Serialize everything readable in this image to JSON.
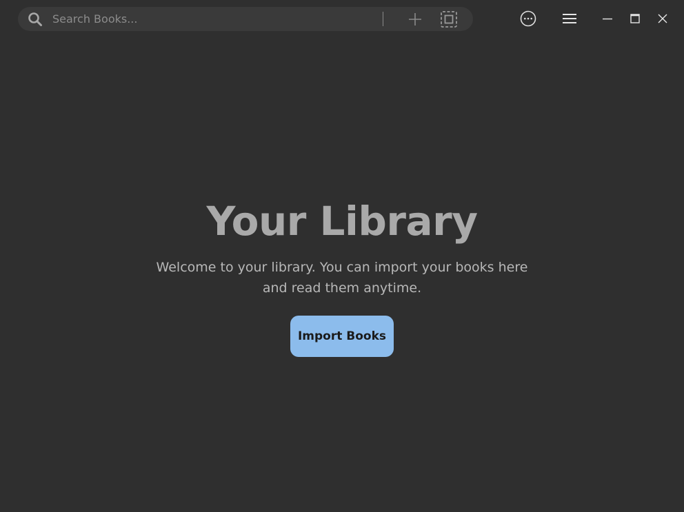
{
  "search": {
    "placeholder": "Search Books...",
    "value": ""
  },
  "icons": {
    "search": "search-icon",
    "add": "plus-icon",
    "select": "dashed-select-icon",
    "more": "more-options-icon",
    "menu": "hamburger-menu-icon",
    "minimize": "window-minimize-icon",
    "maximize": "window-maximize-icon",
    "close": "window-close-icon"
  },
  "main": {
    "title": "Your Library",
    "welcome": "Welcome to your library. You can import your books here and read them anytime.",
    "import_label": "Import Books"
  },
  "colors": {
    "background": "#2f2f2f",
    "search_bg": "#3a3a3a",
    "accent": "#8cbcec",
    "title": "#a9a9a9"
  }
}
